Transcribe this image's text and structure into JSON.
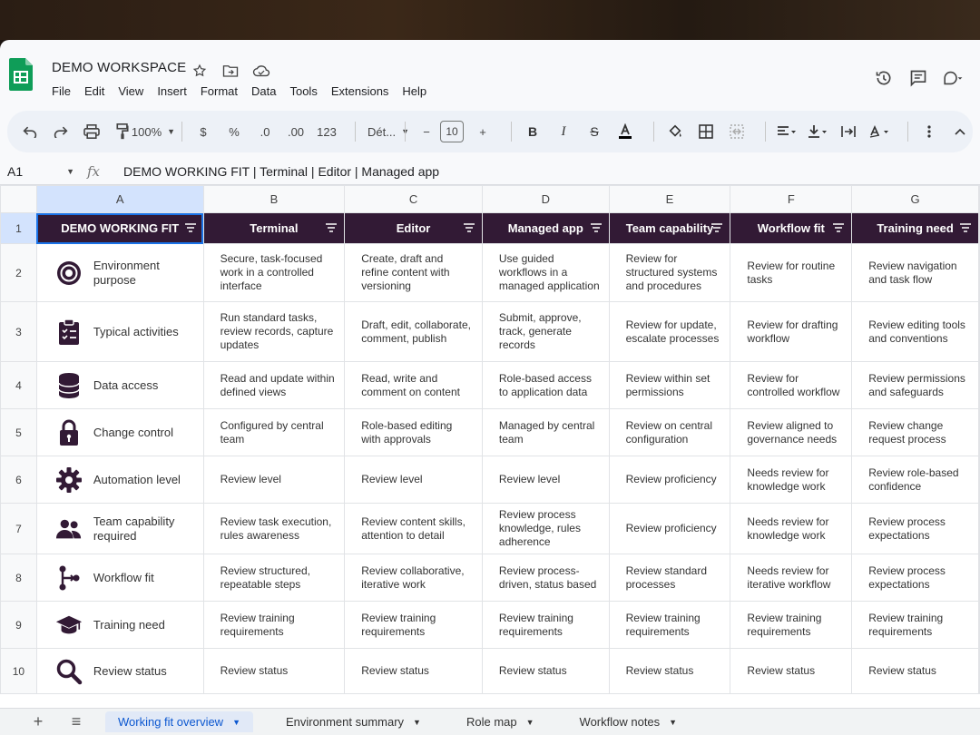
{
  "app": {
    "title": "DEMO WORKSPACE",
    "menu": [
      "File",
      "Edit",
      "View",
      "Insert",
      "Format",
      "Data",
      "Tools",
      "Extensions",
      "Help"
    ]
  },
  "toolbar": {
    "zoom": "100%",
    "currency": "$",
    "percent": "%",
    "dec_decrease": ".0",
    "dec_increase": ".00",
    "number_format": "123",
    "font": "Dét...",
    "minus": "−",
    "font_size": "10",
    "plus": "+"
  },
  "formula_bar": {
    "cell_ref": "A1",
    "fx": "fx",
    "value": "DEMO WORKING FIT  |  Terminal  |  Editor  |  Managed app"
  },
  "sheet": {
    "column_letters": [
      "A",
      "B",
      "C",
      "D",
      "E",
      "F",
      "G"
    ],
    "row_numbers": [
      "1",
      "2",
      "3",
      "4",
      "5",
      "6",
      "7",
      "8",
      "9",
      "10"
    ],
    "header_row": [
      "DEMO WORKING FIT",
      "Terminal",
      "Editor",
      "Managed app",
      "Team capability",
      "Workflow fit",
      "Training need"
    ],
    "rows": [
      {
        "icon": "target-icon",
        "label": "Environment purpose",
        "cells": [
          "Secure, task-focused work in a controlled interface",
          "Create, draft and refine content with versioning",
          "Use guided workflows in a managed application",
          "Review for structured systems and procedures",
          "Review for routine tasks",
          "Review navigation and task flow"
        ]
      },
      {
        "icon": "checklist-icon",
        "label": "Typical activities",
        "cells": [
          "Run standard tasks, review records, capture updates",
          "Draft, edit, collaborate, comment, publish",
          "Submit, approve, track, generate records",
          "Review for update, escalate processes",
          "Review for drafting workflow",
          "Review editing tools and conventions"
        ]
      },
      {
        "icon": "database-icon",
        "label": "Data access",
        "cells": [
          "Read and update within defined views",
          "Read, write and comment on content",
          "Role-based access to application data",
          "Review within set permissions",
          "Review for controlled workflow",
          "Review permissions and safeguards"
        ]
      },
      {
        "icon": "lock-icon",
        "label": "Change control",
        "cells": [
          "Configured by central team",
          "Role-based editing with approvals",
          "Managed by central team",
          "Review on central configuration",
          "Review aligned to governance needs",
          "Review change request process"
        ]
      },
      {
        "icon": "gear-icon",
        "label": "Automation level",
        "cells": [
          "Review level",
          "Review level",
          "Review level",
          "Review proficiency",
          "Needs review for knowledge work",
          "Review role-based confidence"
        ]
      },
      {
        "icon": "team-icon",
        "label": "Team capability required",
        "cells": [
          "Review task execution, rules awareness",
          "Review content skills, attention to detail",
          "Review process knowledge, rules adherence",
          "Review proficiency",
          "Needs review for knowledge work",
          "Review process expectations"
        ]
      },
      {
        "icon": "workflow-icon",
        "label": "Workflow fit",
        "cells": [
          "Review structured, repeatable steps",
          "Review collaborative, iterative work",
          "Review process-driven, status based",
          "Review standard processes",
          "Needs review for iterative workflow",
          "Review process expectations"
        ]
      },
      {
        "icon": "graduation-cap-icon",
        "label": "Training need",
        "cells": [
          "Review training requirements",
          "Review training requirements",
          "Review training requirements",
          "Review training requirements",
          "Review training requirements",
          "Review training requirements"
        ]
      },
      {
        "icon": "magnifier-icon",
        "label": "Review status",
        "cells": [
          "Review status",
          "Review status",
          "Review status",
          "Review status",
          "Review status",
          "Review status"
        ]
      }
    ]
  },
  "tabs": [
    {
      "label": "Working fit overview",
      "active": true
    },
    {
      "label": "Environment summary",
      "active": false
    },
    {
      "label": "Role map",
      "active": false
    },
    {
      "label": "Workflow notes",
      "active": false
    }
  ],
  "colors": {
    "header_bg": "#321a35",
    "selection": "#1a73e8",
    "sheets_green": "#0f9d58"
  }
}
